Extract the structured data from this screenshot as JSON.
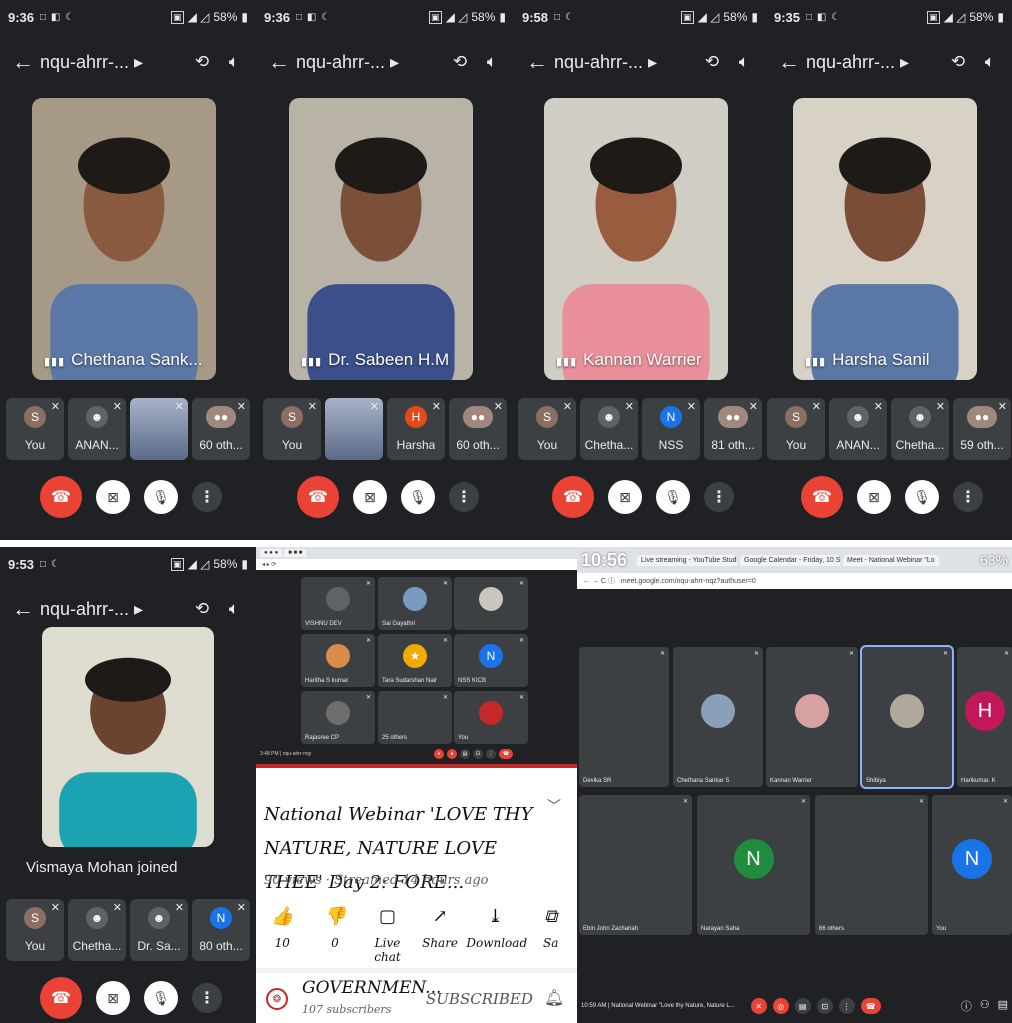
{
  "phones": [
    {
      "time": "9:36",
      "status_icons": "□ ◧ ☾",
      "battery": "58%",
      "title": "nqu-ahrr-... ▸",
      "main_name": "Chethana Sank...",
      "main_bg": "#a69a86",
      "main_skin": "#8a5a40",
      "joined": "",
      "chips": [
        {
          "initial": "S",
          "label": "You",
          "color": "#8d6e63",
          "kind": "avatar"
        },
        {
          "initial": "",
          "label": "ANAN...",
          "color": "#3c4043",
          "kind": "icon"
        },
        {
          "initial": "",
          "label": "",
          "color": "#6e8bb4",
          "kind": "photo"
        },
        {
          "initial": "",
          "label": "60 oth...",
          "color": "#3c4043",
          "kind": "group"
        }
      ]
    },
    {
      "time": "9:36",
      "status_icons": "□ ◧ ☾",
      "battery": "58%",
      "title": "nqu-ahrr-... ▸",
      "main_name": "Dr. Sabeen H.M",
      "main_bg": "#b9b3a7",
      "main_skin": "#7b5038",
      "joined": "",
      "chips": [
        {
          "initial": "S",
          "label": "You",
          "color": "#8d6e63",
          "kind": "avatar"
        },
        {
          "initial": "",
          "label": "",
          "color": "#6e8bb4",
          "kind": "photo"
        },
        {
          "initial": "H",
          "label": "Harsha",
          "color": "#e64a19",
          "kind": "avatar"
        },
        {
          "initial": "",
          "label": "60 oth...",
          "color": "#3c4043",
          "kind": "group"
        }
      ]
    },
    {
      "time": "9:58",
      "status_icons": "□ ☾",
      "battery": "58%",
      "title": "nqu-ahrr-... ▸",
      "main_name": "Kannan Warrier",
      "main_bg": "#cfcdc4",
      "main_skin": "#9a5c3e",
      "joined": "",
      "chips": [
        {
          "initial": "S",
          "label": "You",
          "color": "#8d6e63",
          "kind": "avatar"
        },
        {
          "initial": "",
          "label": "Chetha...",
          "color": "#3c4043",
          "kind": "icon"
        },
        {
          "initial": "N",
          "label": "NSS",
          "color": "#1a73e8",
          "kind": "avatar"
        },
        {
          "initial": "",
          "label": "81 oth...",
          "color": "#3c4043",
          "kind": "group"
        }
      ]
    },
    {
      "time": "9:35",
      "status_icons": "□ ◧ ☾",
      "battery": "58%",
      "title": "nqu-ahrr-... ▸",
      "main_name": "Harsha Sanil",
      "main_bg": "#d8d2c6",
      "main_skin": "#7a4e36",
      "joined": "",
      "chips": [
        {
          "initial": "S",
          "label": "You",
          "color": "#8d6e63",
          "kind": "avatar"
        },
        {
          "initial": "",
          "label": "ANAN...",
          "color": "#3c4043",
          "kind": "icon"
        },
        {
          "initial": "",
          "label": "Chetha...",
          "color": "#3c4043",
          "kind": "icon"
        },
        {
          "initial": "",
          "label": "59 oth...",
          "color": "#3c4043",
          "kind": "group"
        }
      ]
    },
    {
      "time": "9:53",
      "status_icons": "□ ☾",
      "battery": "58%",
      "title": "nqu-ahrr-... ▸",
      "main_name": "",
      "main_bg": "#dfdcd0",
      "main_skin": "#6b4430",
      "joined": "Vismaya Mohan joined",
      "chips": [
        {
          "initial": "S",
          "label": "You",
          "color": "#8d6e63",
          "kind": "avatar"
        },
        {
          "initial": "",
          "label": "Chetha...",
          "color": "#3c4043",
          "kind": "icon"
        },
        {
          "initial": "",
          "label": "Dr. Sa...",
          "color": "#3c4043",
          "kind": "icon"
        },
        {
          "initial": "N",
          "label": "80 oth...",
          "color": "#1a73e8",
          "kind": "avatar"
        }
      ]
    }
  ],
  "desktop_small": {
    "bottom_time": "3:48 PM | nqu-ahrr-nqy",
    "tiles": [
      {
        "name": "VISHNU DEV",
        "initial": "",
        "color": "#5f6368"
      },
      {
        "name": "Sai Gayathri",
        "initial": "",
        "color": "#7a9bc0"
      },
      {
        "name": "",
        "initial": "",
        "color": "#c9c6bd"
      },
      {
        "name": "Haritha S kumar",
        "initial": "",
        "color": "#d98c4a"
      },
      {
        "name": "Tara Sudarshan Nair",
        "initial": "★",
        "color": "#f2a900"
      },
      {
        "name": "NSS KICB",
        "initial": "N",
        "color": "#1a73e8"
      },
      {
        "name": "Rajasree CP",
        "initial": "",
        "color": "#6d6d6d"
      },
      {
        "name": "25 others",
        "initial": "",
        "color": "#3c4043"
      },
      {
        "name": "You",
        "initial": "",
        "color": "#c62828"
      }
    ]
  },
  "youtube": {
    "title": "National Webinar 'LOVE THY NATURE, NATURE LOVE THEE' Day 2: FORE...",
    "meta": "90 views · Streamed 14 hours ago",
    "actions": [
      {
        "icon": "👍",
        "label": "10"
      },
      {
        "icon": "👎",
        "label": "0"
      },
      {
        "icon": "▢",
        "label": "Live chat"
      },
      {
        "icon": "↗",
        "label": "Share"
      },
      {
        "icon": "⤓",
        "label": "Download"
      },
      {
        "icon": "⧉",
        "label": "Sa"
      }
    ],
    "channel": "GOVERNMEN...",
    "subscribers": "107 subscribers",
    "subscribe_label": "SUBSCRIBED"
  },
  "desktop_large": {
    "time": "10:56",
    "battery": "63%",
    "tabs": [
      "Live streaming - YouTube Studio",
      "Google Calendar - Friday, 10 Se",
      "Meet - National Webinar \"Lo"
    ],
    "url": "meet.google.com/nqu-ahrr-nqz?authuser=0",
    "bottom_text": "10:59 AM | National Webinar \"Love thy Nature, Nature L...",
    "tiles": [
      {
        "name": "Devika SR",
        "initial": "",
        "color": "#3c4043"
      },
      {
        "name": "Chethana Sankar S",
        "initial": "",
        "color": "#8aa0b8"
      },
      {
        "name": "Kannan Warrier",
        "initial": "",
        "color": "#d6a1a0"
      },
      {
        "name": "Shibiya",
        "initial": "",
        "color": "#b1a89c"
      },
      {
        "name": "Harikumar. K",
        "initial": "H",
        "color": "#c2185b"
      },
      {
        "name": "Ebin John Zachariah",
        "initial": "",
        "color": "#3c4043"
      },
      {
        "name": "Narayan Saha",
        "initial": "N",
        "color": "#1e8e3e"
      },
      {
        "name": "66 others",
        "initial": "",
        "color": "#3c4043"
      },
      {
        "name": "You",
        "initial": "N",
        "color": "#1a73e8"
      }
    ]
  }
}
